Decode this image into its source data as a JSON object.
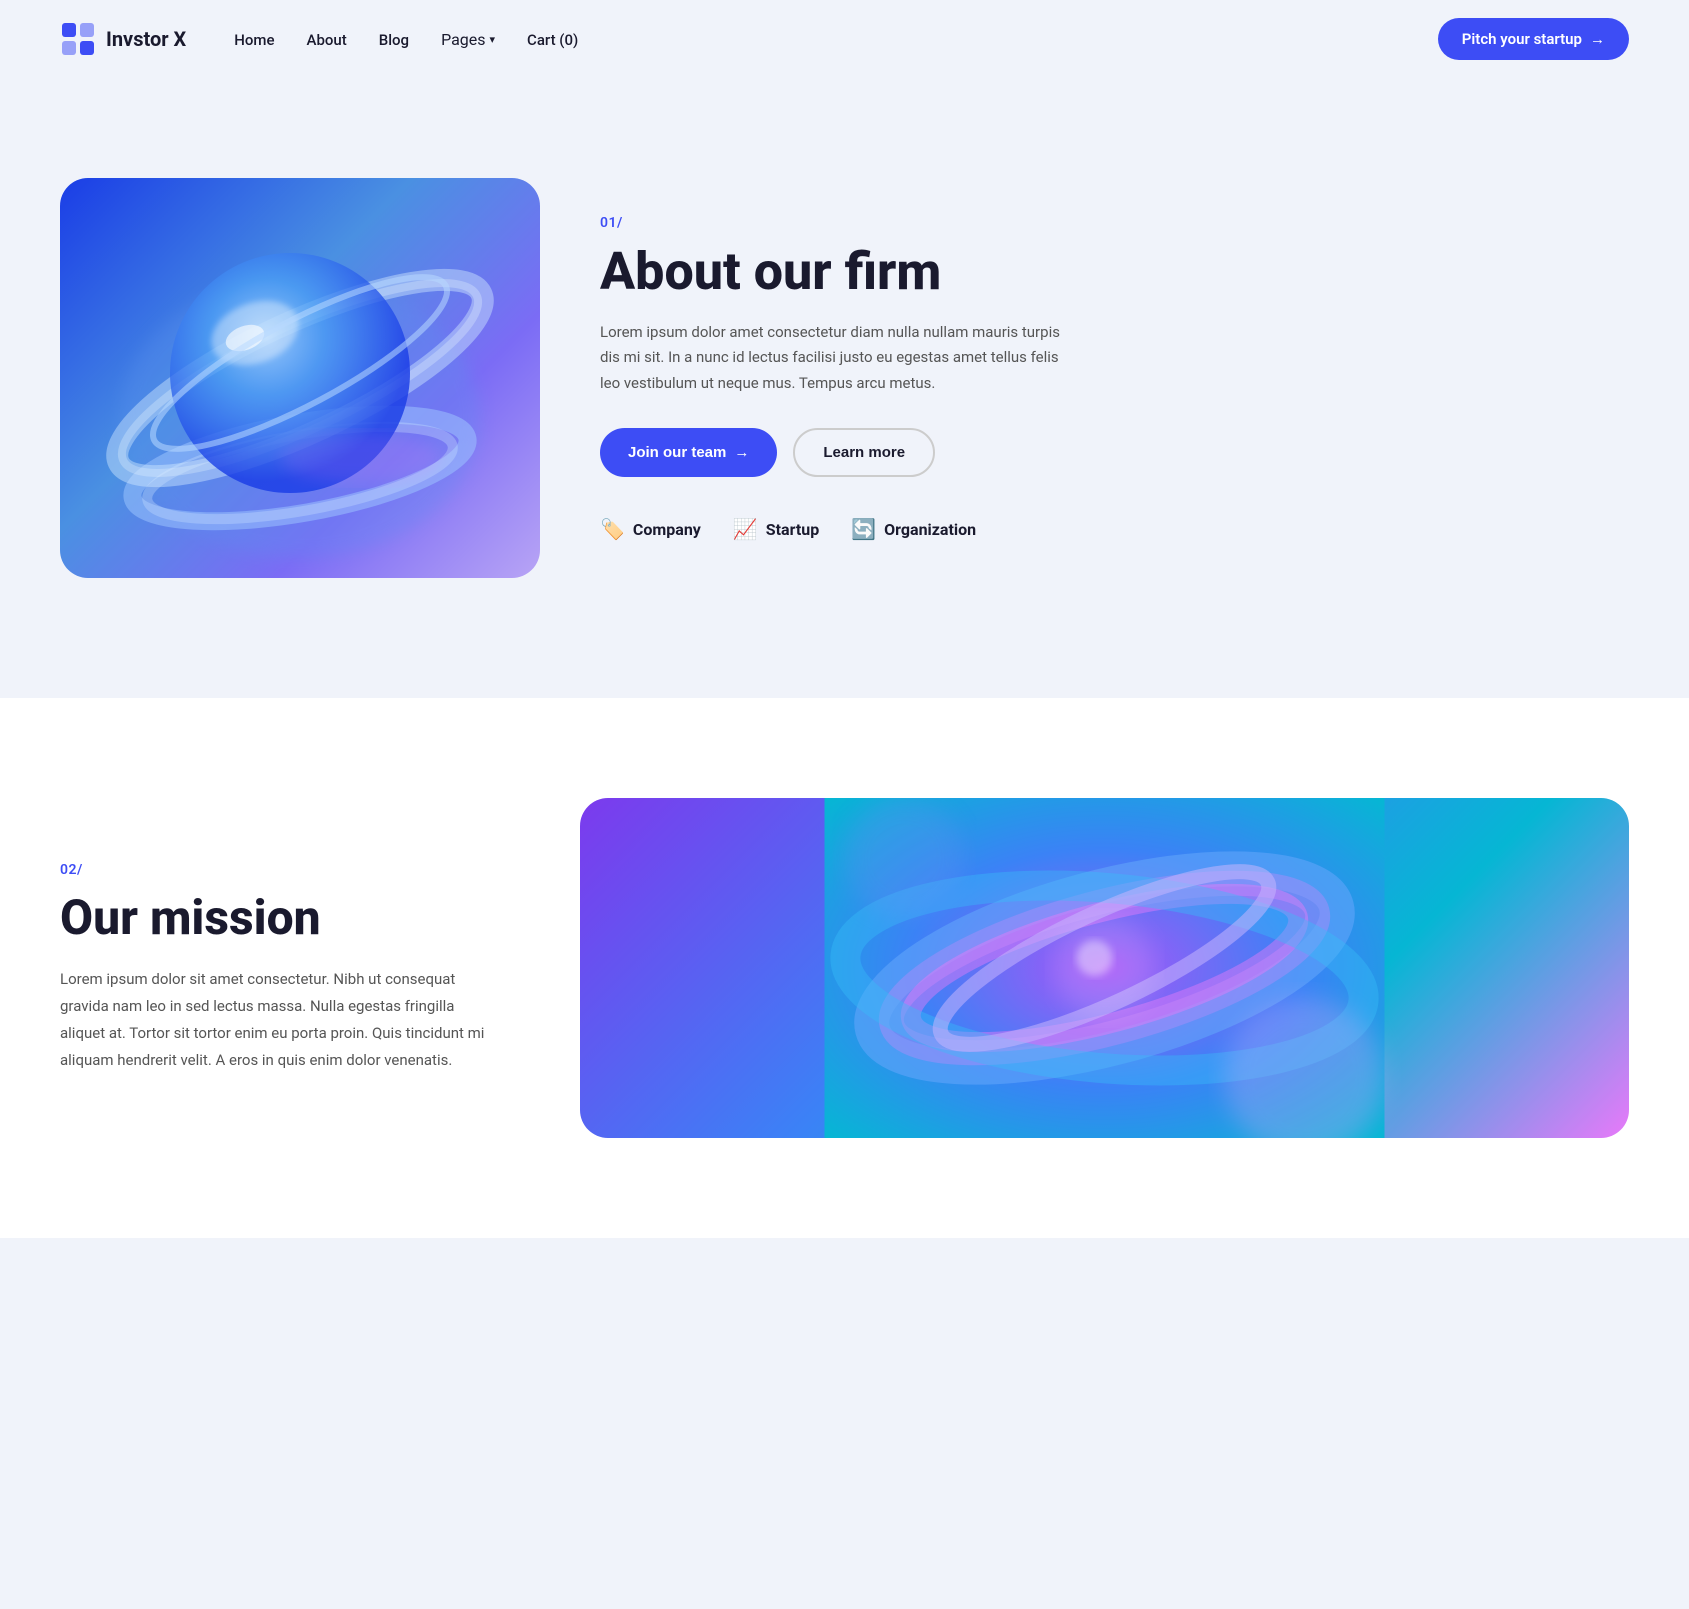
{
  "brand": {
    "name": "Invstor X"
  },
  "nav": {
    "links": [
      {
        "label": "Home",
        "id": "home"
      },
      {
        "label": "About",
        "id": "about"
      },
      {
        "label": "Blog",
        "id": "blog"
      },
      {
        "label": "Pages",
        "id": "pages",
        "has_dropdown": true
      },
      {
        "label": "Cart (0)",
        "id": "cart"
      }
    ],
    "cta": {
      "label": "Pitch your startup",
      "arrow": "→"
    }
  },
  "section1": {
    "number": "01/",
    "title": "About our firm",
    "description": "Lorem ipsum dolor amet consectetur diam nulla nullam mauris turpis dis mi sit. In a nunc id lectus facilisi justo eu egestas amet tellus felis leo vestibulum ut neque mus. Tempus arcu metus.",
    "btn_primary": "Join our team",
    "btn_primary_arrow": "→",
    "btn_secondary": "Learn more",
    "partners": [
      {
        "label": "Company",
        "icon": "🏷️"
      },
      {
        "label": "Startup",
        "icon": "📈"
      },
      {
        "label": "Organization",
        "icon": "🔄"
      }
    ]
  },
  "section2": {
    "number": "02/",
    "title": "Our mission",
    "description": "Lorem ipsum dolor sit amet consectetur. Nibh ut consequat gravida nam leo in sed lectus massa. Nulla egestas fringilla aliquet at. Tortor sit tortor enim eu porta proin. Quis tincidunt mi aliquam hendrerit velit. A eros in quis enim dolor venenatis."
  },
  "colors": {
    "accent": "#3d4df5",
    "text_dark": "#1a1a2e",
    "bg_light": "#f0f3fa"
  }
}
